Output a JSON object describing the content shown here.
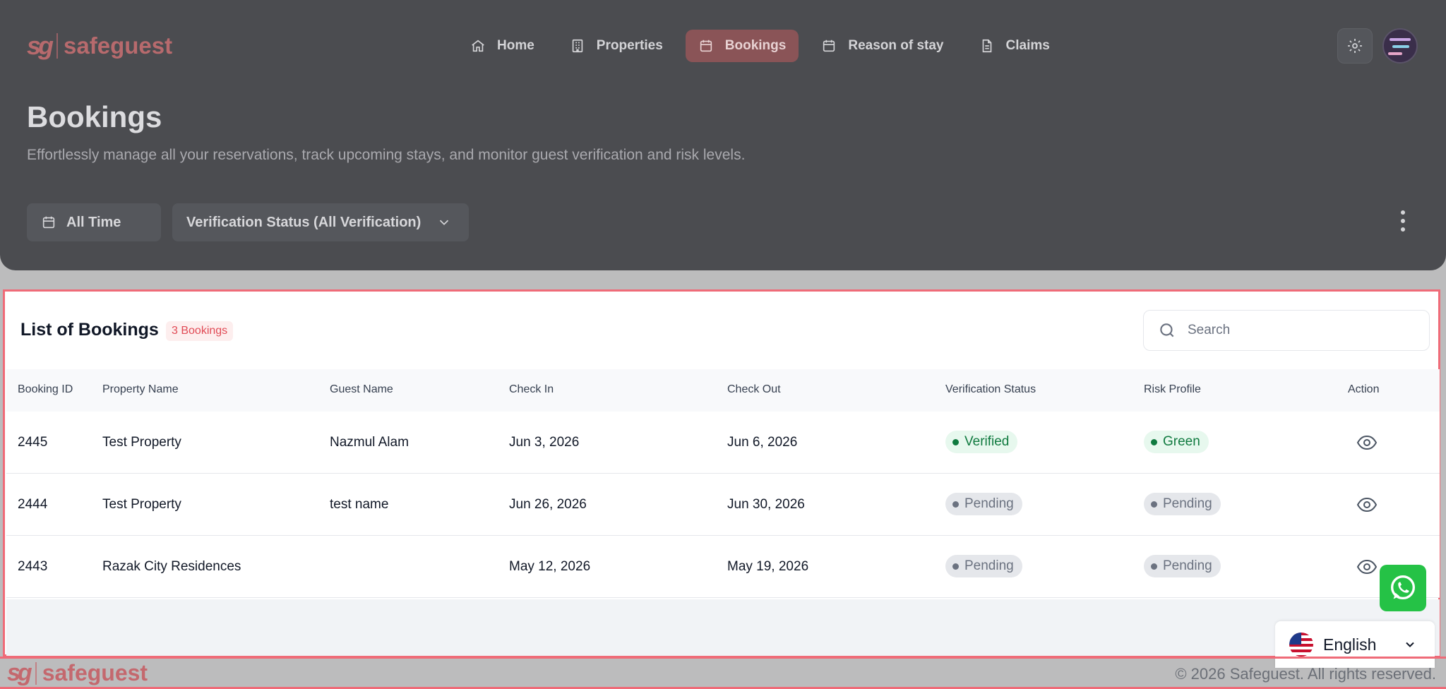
{
  "app": {
    "logo_mark": "sg",
    "logo_text": "safeguest"
  },
  "nav": {
    "items": [
      {
        "label": "Home",
        "icon": "home-icon"
      },
      {
        "label": "Properties",
        "icon": "building-icon"
      },
      {
        "label": "Bookings",
        "icon": "calendar-icon",
        "active": true
      },
      {
        "label": "Reason of stay",
        "icon": "calendar-icon"
      },
      {
        "label": "Claims",
        "icon": "document-icon"
      }
    ]
  },
  "header": {
    "title": "Bookings",
    "subtitle": "Effortlessly manage all your reservations, track upcoming stays, and monitor guest verification and risk levels."
  },
  "filters": {
    "time": "All Time",
    "verification": "Verification Status (All Verification)"
  },
  "list": {
    "title": "List of Bookings",
    "count_label": "3 Bookings",
    "search_placeholder": "Search",
    "columns": [
      "Booking ID",
      "Property Name",
      "Guest Name",
      "Check In",
      "Check Out",
      "Verification Status",
      "Risk Profile",
      "Action"
    ],
    "rows": [
      {
        "id": "2445",
        "property": "Test Property",
        "guest": "Nazmul Alam",
        "check_in": "Jun 3, 2026",
        "check_out": "Jun 6, 2026",
        "verification": "Verified",
        "risk": "Green"
      },
      {
        "id": "2444",
        "property": "Test Property",
        "guest": "test name",
        "check_in": "Jun 26, 2026",
        "check_out": "Jun 30, 2026",
        "verification": "Pending",
        "risk": "Pending"
      },
      {
        "id": "2443",
        "property": "Razak City Residences",
        "guest": "",
        "check_in": "May 12, 2026",
        "check_out": "May 19, 2026",
        "verification": "Pending",
        "risk": "Pending"
      }
    ]
  },
  "language": {
    "label": "English"
  },
  "footer": {
    "logo_mark": "sg",
    "logo_text": "safeguest",
    "copyright": "© 2026 Safeguest. All rights reserved."
  },
  "colors": {
    "brand": "#ef6b78",
    "verified": "#0f7a3f",
    "pending": "#6b7280",
    "whatsapp": "#25c246"
  }
}
